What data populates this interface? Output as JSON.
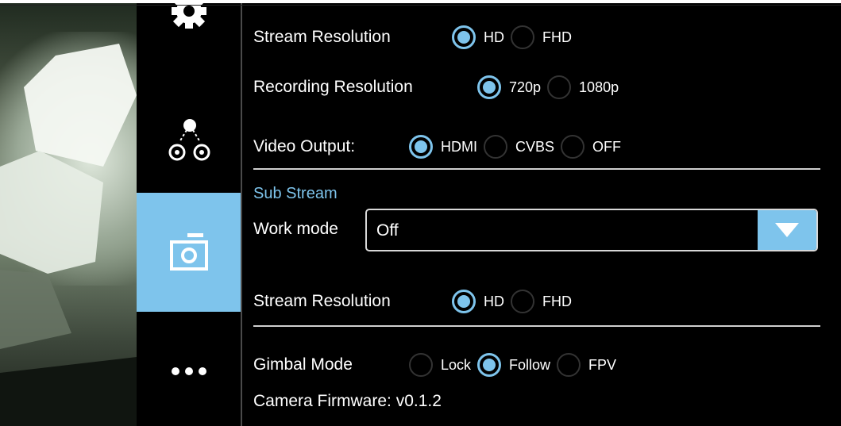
{
  "sidebar": {
    "items": [
      {
        "icon": "gear-icon",
        "active": false
      },
      {
        "icon": "gimbal-icon",
        "active": false
      },
      {
        "icon": "camera-icon",
        "active": true
      },
      {
        "icon": "more-icon",
        "active": false
      }
    ]
  },
  "settings": {
    "stream_resolution": {
      "label": "Stream Resolution",
      "options": [
        "HD",
        "FHD"
      ],
      "selected": "HD"
    },
    "recording_resolution": {
      "label": "Recording Resolution",
      "options": [
        "720p",
        "1080p"
      ],
      "selected": "720p"
    },
    "video_output": {
      "label": "Video Output:",
      "options": [
        "HDMI",
        "CVBS",
        "OFF"
      ],
      "selected": "HDMI"
    },
    "sub_stream": {
      "title": "Sub Stream",
      "work_mode": {
        "label": "Work mode",
        "value": "Off"
      },
      "stream_resolution": {
        "label": "Stream Resolution",
        "options": [
          "HD",
          "FHD"
        ],
        "selected": "HD"
      }
    },
    "gimbal_mode": {
      "label": "Gimbal Mode",
      "options": [
        "Lock",
        "Follow",
        "FPV"
      ],
      "selected": "Follow"
    },
    "camera_firmware": "Camera Firmware: v0.1.2"
  },
  "colors": {
    "accent": "#7ec4ec",
    "background": "#000000",
    "text": "#ffffff"
  }
}
